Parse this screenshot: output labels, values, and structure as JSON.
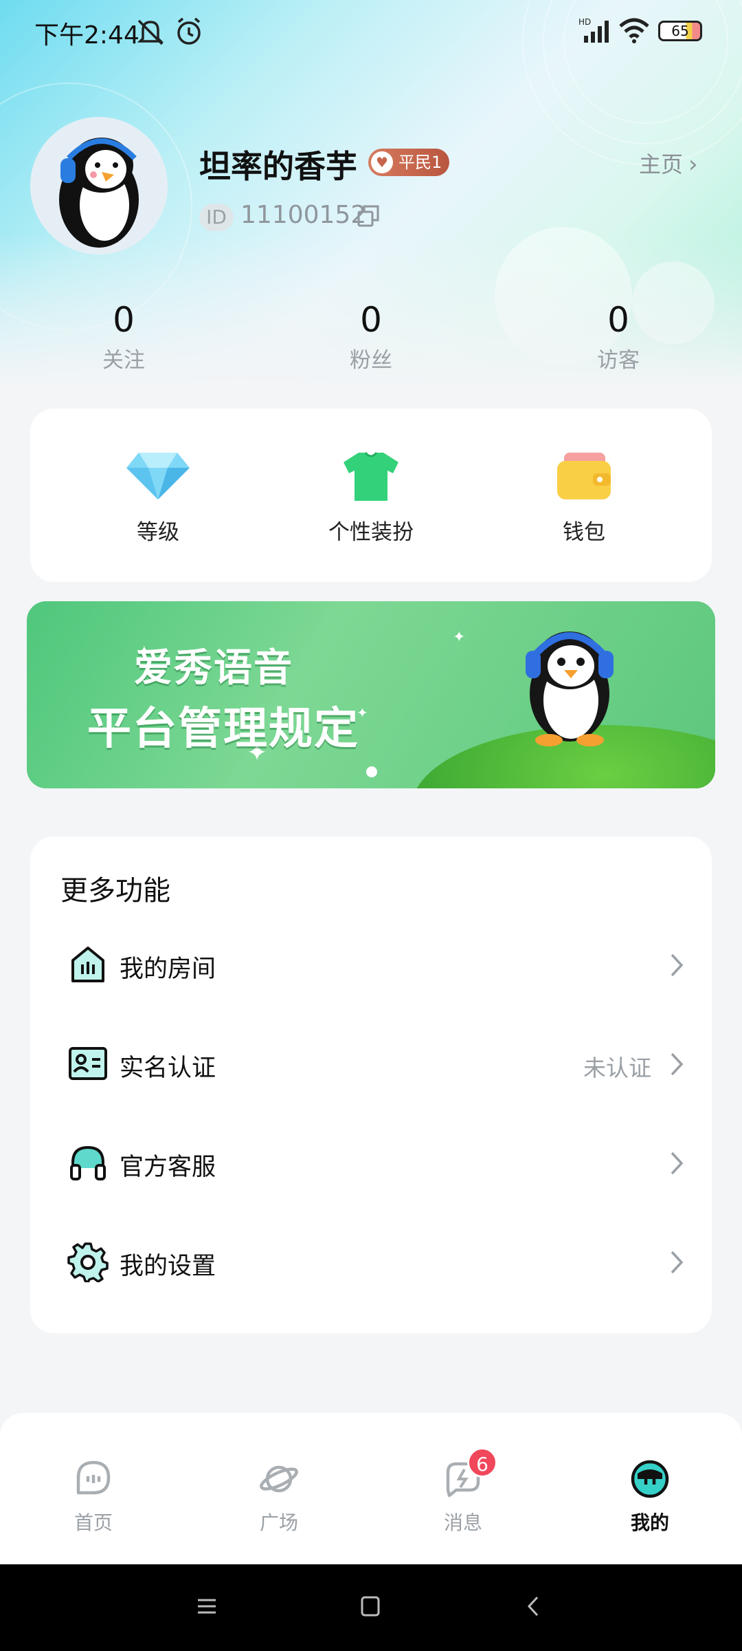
{
  "status_bar": {
    "time": "下午2:44",
    "battery": "65"
  },
  "profile": {
    "username": "坦率的香芋",
    "rank_badge": "平民1",
    "homepage_link": "主页",
    "id_tag": "ID",
    "id_value": "11100152"
  },
  "stats": [
    {
      "value": "0",
      "label": "关注"
    },
    {
      "value": "0",
      "label": "粉丝"
    },
    {
      "value": "0",
      "label": "访客"
    }
  ],
  "quick_actions": [
    {
      "label": "等级",
      "icon": "diamond-icon"
    },
    {
      "label": "个性装扮",
      "icon": "shirt-icon"
    },
    {
      "label": "钱包",
      "icon": "wallet-icon"
    }
  ],
  "banner": {
    "title_line1": "爱秀语音",
    "title_line2": "平台管理规定"
  },
  "more_functions": {
    "title": "更多功能",
    "items": [
      {
        "label": "我的房间",
        "value": "",
        "icon": "room-icon"
      },
      {
        "label": "实名认证",
        "value": "未认证",
        "icon": "id-card-icon"
      },
      {
        "label": "官方客服",
        "value": "",
        "icon": "headset-icon"
      },
      {
        "label": "我的设置",
        "value": "",
        "icon": "gear-icon"
      }
    ]
  },
  "tabs": [
    {
      "label": "首页",
      "icon": "home-chat-icon",
      "active": false
    },
    {
      "label": "广场",
      "icon": "planet-icon",
      "active": false
    },
    {
      "label": "消息",
      "icon": "message-icon",
      "active": false,
      "badge": "6"
    },
    {
      "label": "我的",
      "icon": "profile-face-icon",
      "active": true
    }
  ],
  "colors": {
    "accent_teal": "#35d0c8",
    "badge_red": "#f0475a",
    "rank_badge": "#c7654c"
  }
}
